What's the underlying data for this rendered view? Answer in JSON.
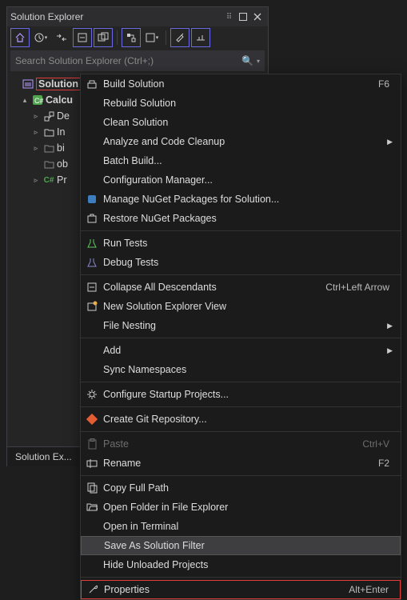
{
  "panel": {
    "title": "Solution Explorer",
    "search_placeholder": "Search Solution Explorer (Ctrl+;)",
    "tab_label": "Solution Ex..."
  },
  "tree": {
    "solution_label": "Solution",
    "project_label": "Calcu",
    "items": [
      {
        "label": "De"
      },
      {
        "label": "In"
      },
      {
        "label": "bi"
      },
      {
        "label": "ob"
      },
      {
        "label": "Pr"
      }
    ]
  },
  "menu": {
    "build": "Build Solution",
    "build_key": "F6",
    "rebuild": "Rebuild Solution",
    "clean": "Clean Solution",
    "analyze": "Analyze and Code Cleanup",
    "batch": "Batch Build...",
    "config": "Configuration Manager...",
    "nuget_manage": "Manage NuGet Packages for Solution...",
    "nuget_restore": "Restore NuGet Packages",
    "run_tests": "Run Tests",
    "debug_tests": "Debug Tests",
    "collapse": "Collapse All Descendants",
    "collapse_key": "Ctrl+Left Arrow",
    "new_view": "New Solution Explorer View",
    "file_nesting": "File Nesting",
    "add": "Add",
    "sync_ns": "Sync Namespaces",
    "startup": "Configure Startup Projects...",
    "git": "Create Git Repository...",
    "paste": "Paste",
    "paste_key": "Ctrl+V",
    "rename": "Rename",
    "rename_key": "F2",
    "copy_path": "Copy Full Path",
    "open_folder": "Open Folder in File Explorer",
    "open_terminal": "Open in Terminal",
    "save_filter": "Save As Solution Filter",
    "hide_unloaded": "Hide Unloaded Projects",
    "properties": "Properties",
    "properties_key": "Alt+Enter"
  }
}
